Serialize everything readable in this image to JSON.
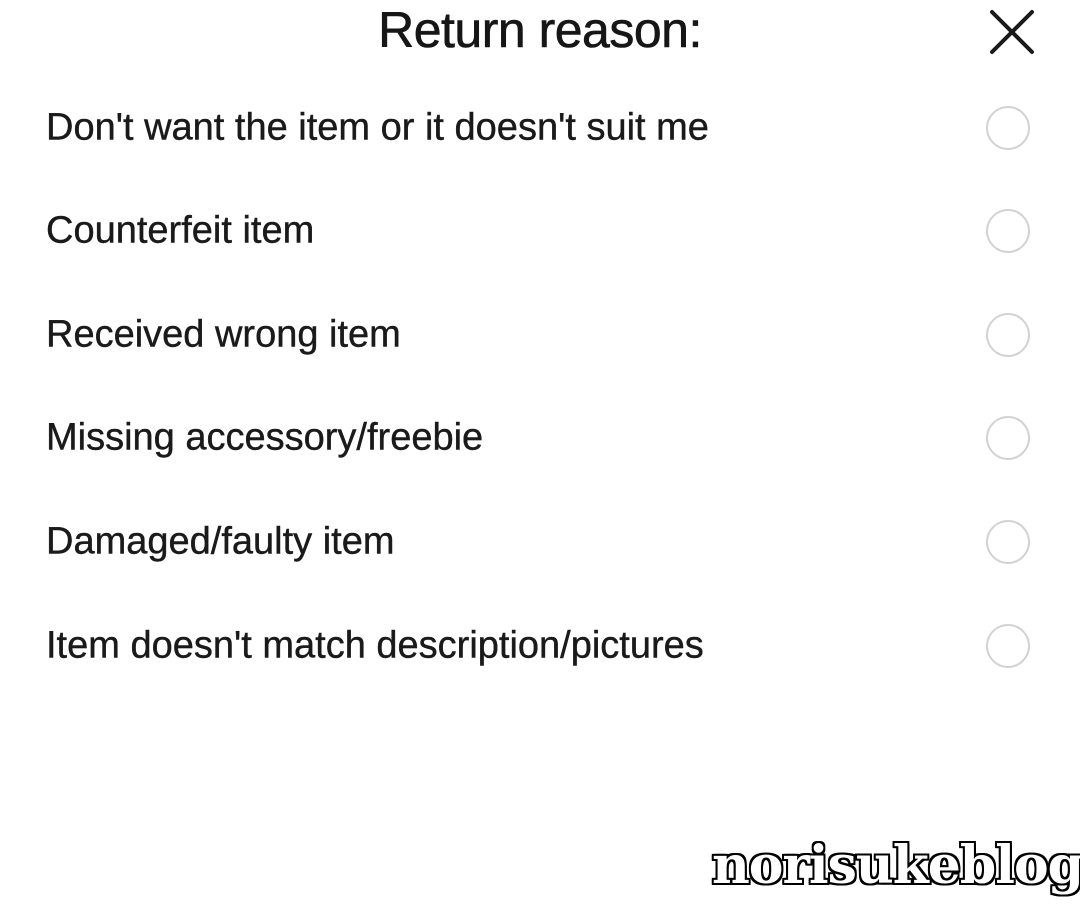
{
  "sheet": {
    "title": "Return reason:",
    "close_icon": "close-icon"
  },
  "reasons": [
    {
      "label": "Don't want the item or it doesn't suit me",
      "selected": false
    },
    {
      "label": "Counterfeit item",
      "selected": false
    },
    {
      "label": "Received wrong item",
      "selected": false
    },
    {
      "label": "Missing accessory/freebie",
      "selected": false
    },
    {
      "label": "Damaged/faulty item",
      "selected": false
    },
    {
      "label": "Item doesn't match description/pictures",
      "selected": false
    }
  ],
  "watermark": {
    "text": "norisukeblog"
  },
  "colors": {
    "text": "#1a1a1a",
    "radio_border": "#d2d2d2",
    "background": "#ffffff"
  }
}
